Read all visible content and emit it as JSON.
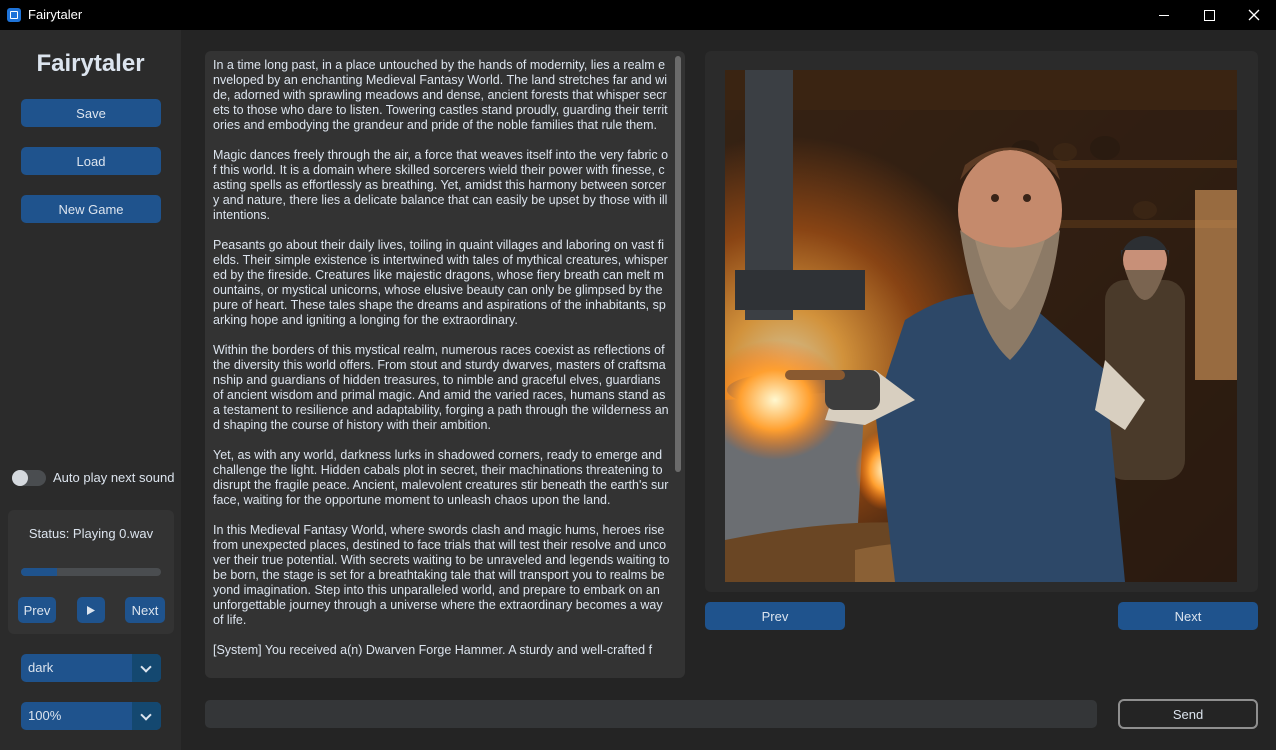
{
  "window": {
    "title": "Fairytaler"
  },
  "sidebar": {
    "app_name": "Fairytaler",
    "save_label": "Save",
    "load_label": "Load",
    "new_game_label": "New Game",
    "autoplay_label": "Auto play next sound",
    "autoplay_on": false,
    "status_text": "Status: Playing 0.wav",
    "progress": 0.26,
    "prev_label": "Prev",
    "play_icon": "play-icon",
    "next_label": "Next",
    "theme_value": "dark",
    "scale_value": "100%"
  },
  "story": {
    "text": "In a time long past, in a place untouched by the hands of modernity, lies a realm enveloped by an enchanting Medieval Fantasy World. The land stretches far and wide, adorned with sprawling meadows and dense, ancient forests that whisper secrets to those who dare to listen. Towering castles stand proudly, guarding their territories and embodying the grandeur and pride of the noble families that rule them.\n\nMagic dances freely through the air, a force that weaves itself into the very fabric of this world. It is a domain where skilled sorcerers wield their power with finesse, casting spells as effortlessly as breathing. Yet, amidst this harmony between sorcery and nature, there lies a delicate balance that can easily be upset by those with ill intentions.\n\nPeasants go about their daily lives, toiling in quaint villages and laboring on vast fields. Their simple existence is intertwined with tales of mythical creatures, whispered by the fireside. Creatures like majestic dragons, whose fiery breath can melt mountains, or mystical unicorns, whose elusive beauty can only be glimpsed by the pure of heart. These tales shape the dreams and aspirations of the inhabitants, sparking hope and igniting a longing for the extraordinary.\n\nWithin the borders of this mystical realm, numerous races coexist as reflections of the diversity this world offers. From stout and sturdy dwarves, masters of craftsmanship and guardians of hidden treasures, to nimble and graceful elves, guardians of ancient wisdom and primal magic. And amid the varied races, humans stand as a testament to resilience and adaptability, forging a path through the wilderness and shaping the course of history with their ambition.\n\nYet, as with any world, darkness lurks in shadowed corners, ready to emerge and challenge the light. Hidden cabals plot in secret, their machinations threatening to disrupt the fragile peace. Ancient, malevolent creatures stir beneath the earth's surface, waiting for the opportune moment to unleash chaos upon the land.\n\nIn this Medieval Fantasy World, where swords clash and magic hums, heroes rise from unexpected places, destined to face trials that will test their resolve and uncover their true potential. With secrets waiting to be unraveled and legends waiting to be born, the stage is set for a breathtaking tale that will transport you to realms beyond imagination. Step into this unparalleled world, and prepare to embark on an unforgettable journey through a universe where the extraordinary becomes a way of life.\n\n[System] You received a(n) Dwarven Forge Hammer. A sturdy and well-crafted f"
  },
  "image_panel": {
    "prev_label": "Prev",
    "next_label": "Next"
  },
  "input": {
    "placeholder": "",
    "send_label": "Send"
  },
  "colors": {
    "accent": "#1f538d",
    "background": "#242424",
    "panel": "#2b2b2b"
  }
}
